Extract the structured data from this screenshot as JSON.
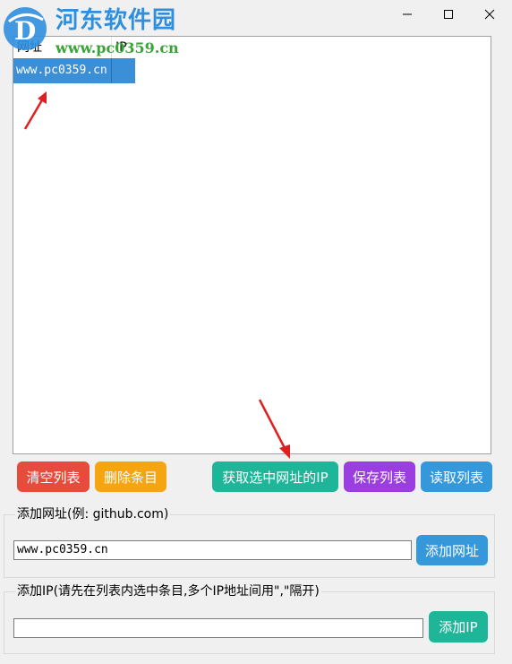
{
  "watermark": {
    "name": "河东软件园",
    "url": "www.pc0359.cn",
    "logo_text": "D"
  },
  "window": {
    "minimize_icon": "minimize-icon",
    "maximize_icon": "maximize-icon",
    "close_icon": "close-icon"
  },
  "list": {
    "columns": [
      "网址",
      "IP"
    ],
    "rows": [
      {
        "url": "www.pc0359.cn",
        "ip": ""
      }
    ],
    "selected_row": 0
  },
  "toolbar": {
    "clear_label": "清空列表",
    "delete_label": "删除条目",
    "getip_label": "获取选中网址的IP",
    "save_label": "保存列表",
    "read_label": "读取列表"
  },
  "add_url": {
    "group_title": "添加网址(例: github.com)",
    "input_value": "www.pc0359.cn",
    "button_label": "添加网址"
  },
  "add_ip": {
    "group_title": "添加IP(请先在列表内选中条目,多个IP地址间用\",\"隔开)",
    "input_value": "",
    "button_label": "添加IP"
  },
  "colors": {
    "clear": "#e64c3c",
    "delete": "#f5a511",
    "getip": "#1fb598",
    "save": "#9b3ee0",
    "read": "#3498db",
    "selection": "#3b8fd6",
    "annotation_arrow": "#e02020"
  }
}
